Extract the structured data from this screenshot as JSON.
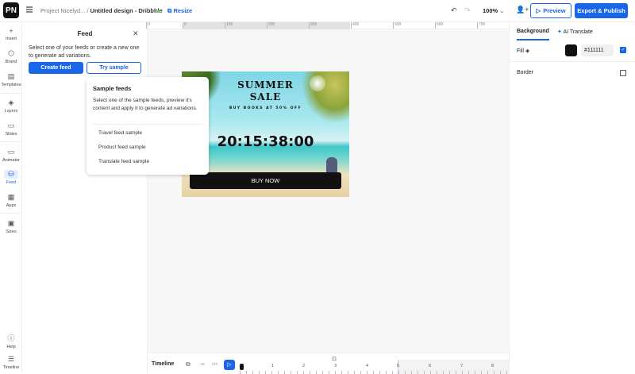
{
  "header": {
    "logo": "PN",
    "project": "Project Nicelyd...",
    "separator": "/",
    "design_title": "Untitled design - Dribbble",
    "resize_label": "Resize",
    "zoom": "100%",
    "preview_label": "Preview",
    "export_label": "Export & Publish"
  },
  "leftnav": {
    "items": [
      {
        "label": "Insert",
        "icon": "plus"
      },
      {
        "label": "Brand",
        "icon": "brand"
      },
      {
        "label": "Templates",
        "icon": "templates"
      },
      {
        "label": "Layers",
        "icon": "layers"
      },
      {
        "label": "Slides",
        "icon": "slides"
      },
      {
        "label": "Animator",
        "icon": "video"
      },
      {
        "label": "Feed",
        "icon": "database",
        "active": true
      },
      {
        "label": "Apps",
        "icon": "grid"
      },
      {
        "label": "Sizes",
        "icon": "sizes"
      },
      {
        "label": "Help",
        "icon": "help"
      },
      {
        "label": "Timeline",
        "icon": "timeline"
      }
    ]
  },
  "feed_panel": {
    "title": "Feed",
    "description": "Select one of your feeds or create a new one to generate ad variations.",
    "create_label": "Create feed",
    "try_label": "Try sample"
  },
  "sample_popup": {
    "title": "Sample feeds",
    "description": "Select one of the sample feeds, preview it's content and apply it to generate ad variations.",
    "items": [
      "Travel feed sample",
      "Product feed sample",
      "Translate feed sample"
    ]
  },
  "ruler": {
    "ticks": [
      "0",
      "0",
      "100",
      "200",
      "300",
      "400",
      "500",
      "600",
      "700"
    ]
  },
  "artwork": {
    "title1": "SUMMER",
    "title2": "SALE",
    "subtitle": "BUY BOOKS AT 50% OFF",
    "countdown": "20:15:38:00",
    "cta": "BUY NOW"
  },
  "right_panel": {
    "tabs": [
      "Background",
      "AI Translate"
    ],
    "fill_label": "Fill",
    "fill_color": "#111111",
    "fill_enabled": true,
    "border_label": "Border",
    "border_enabled": false
  },
  "timeline": {
    "label": "Timeline",
    "marks": [
      "1",
      "2",
      "3",
      "4",
      "5",
      "6",
      "7",
      "8"
    ]
  },
  "colors": {
    "accent": "#1a66e8"
  }
}
